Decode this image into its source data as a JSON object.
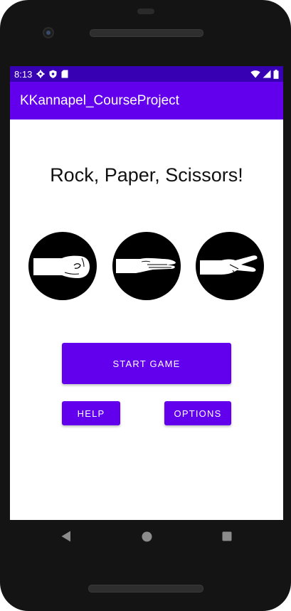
{
  "status_bar": {
    "time": "8:13",
    "left_icons": [
      "gear-icon",
      "shield-icon",
      "sd-card-icon"
    ],
    "right_icons": [
      "wifi-icon",
      "signal-icon",
      "battery-icon"
    ]
  },
  "app_bar": {
    "title": "KKannapel_CourseProject"
  },
  "main": {
    "heading": "Rock, Paper, Scissors!",
    "choices": [
      {
        "name": "rock",
        "icon": "rock-fist-icon"
      },
      {
        "name": "paper",
        "icon": "paper-hand-icon"
      },
      {
        "name": "scissors",
        "icon": "scissors-hand-icon"
      }
    ],
    "start_label": "START GAME",
    "help_label": "HELP",
    "options_label": "OPTIONS"
  },
  "nav_bar": {
    "buttons": [
      "back-icon",
      "home-icon",
      "recents-icon"
    ]
  },
  "colors": {
    "primary": "#6200ee",
    "primary_dark": "#3700b3"
  }
}
